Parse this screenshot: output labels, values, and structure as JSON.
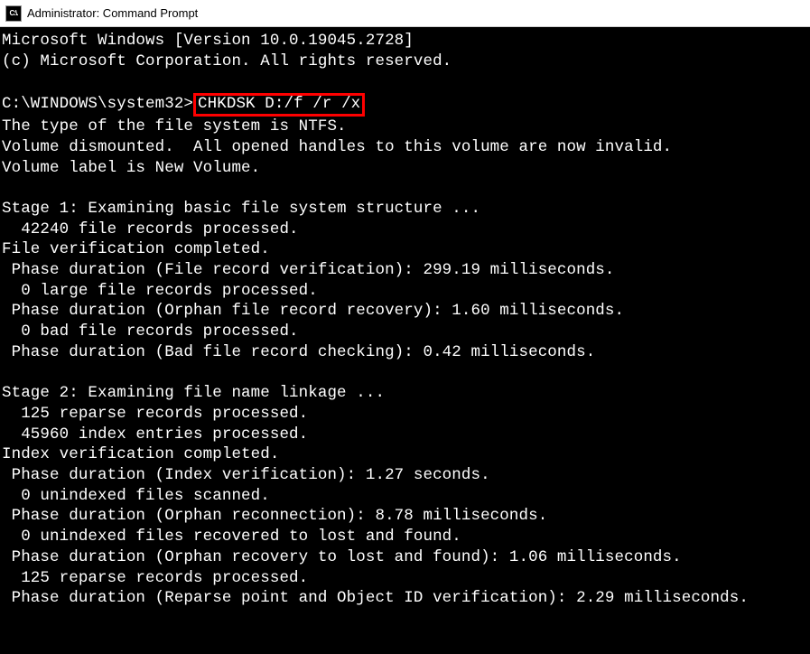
{
  "window": {
    "title": "Administrator: Command Prompt",
    "icon_label": "C:\\."
  },
  "term": {
    "l00": "Microsoft Windows [Version 10.0.19045.2728]",
    "l01": "(c) Microsoft Corporation. All rights reserved.",
    "l02": "",
    "prompt": "C:\\WINDOWS\\system32>",
    "command": "CHKDSK D:/f /r /x",
    "l04": "The type of the file system is NTFS.",
    "l05": "Volume dismounted.  All opened handles to this volume are now invalid.",
    "l06": "Volume label is New Volume.",
    "l07": "",
    "l08": "Stage 1: Examining basic file system structure ...",
    "l09": "  42240 file records processed.",
    "l10": "File verification completed.",
    "l11": " Phase duration (File record verification): 299.19 milliseconds.",
    "l12": "  0 large file records processed.",
    "l13": " Phase duration (Orphan file record recovery): 1.60 milliseconds.",
    "l14": "  0 bad file records processed.",
    "l15": " Phase duration (Bad file record checking): 0.42 milliseconds.",
    "l16": "",
    "l17": "Stage 2: Examining file name linkage ...",
    "l18": "  125 reparse records processed.",
    "l19": "  45960 index entries processed.",
    "l20": "Index verification completed.",
    "l21": " Phase duration (Index verification): 1.27 seconds.",
    "l22": "  0 unindexed files scanned.",
    "l23": " Phase duration (Orphan reconnection): 8.78 milliseconds.",
    "l24": "  0 unindexed files recovered to lost and found.",
    "l25": " Phase duration (Orphan recovery to lost and found): 1.06 milliseconds.",
    "l26": "  125 reparse records processed.",
    "l27": " Phase duration (Reparse point and Object ID verification): 2.29 milliseconds."
  }
}
